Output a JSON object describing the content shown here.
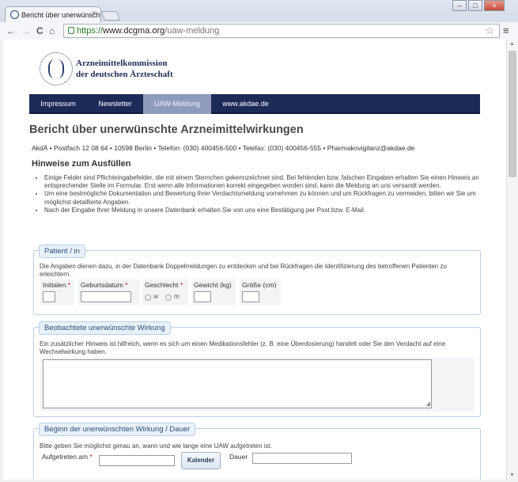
{
  "browser": {
    "tab_title": "Bericht über unerwünschte",
    "tab_close": "×",
    "url_scheme": "https://",
    "url_host": "www.dcgma.org",
    "url_path": "/uaw-meldung",
    "back": "←",
    "forward": "→",
    "reload": "C",
    "home": "⌂",
    "star": "☆",
    "menu": "≡",
    "minimize": "–",
    "maximize": "□",
    "close": "×"
  },
  "header": {
    "org_line1": "Arzneimittelkommission",
    "org_line2": "der deutschen Ärzteschaft"
  },
  "nav": {
    "items": [
      {
        "label": "Impressum"
      },
      {
        "label": "Newsletter"
      },
      {
        "label": "UAW-Meldung"
      },
      {
        "label": "www.akdae.de"
      }
    ]
  },
  "page": {
    "title": "Bericht über unerwünschte Arzneimittelwirkungen",
    "contact": "AkdÄ • Postfach 12 08 64 • 10598 Berlin • Telefon: (030) 400456-500 • Telefax: (030) 400456-555 • Pharmakovigilanz@akdae.de",
    "hints_title": "Hinweise zum Ausfüllen",
    "hints": [
      "Einige Felder sind Pflichteingabefelder, die mit einem Sternchen gekennzeichnet sind. Bei fehlenden bzw. falschen Eingaben erhalten Sie einen Hinweis an entsprechender Stelle im Formular. Erst wenn alle Informationen korrekt eingegeben worden sind, kann die Meldung an uns versandt werden.",
      "Um eine bestmögliche Dokumentation und Bewertung Ihrer Verdachtsmeldung vornehmen zu können und um Rückfragen zu vermeiden, bitten wir Sie um möglichst detaillierte Angaben.",
      "Nach der Eingabe Ihrer Meldung in unsere Datenbank erhalten Sie von uns eine Bestätigung per Post bzw. E-Mail."
    ]
  },
  "patient": {
    "legend": "Patient / in",
    "desc": "Die Angaben dienen dazu, in der Datenbank Doppelmeldungen zu entdecken und bei Rückfragen die Identifizierung des betroffenen Patienten zu erleichtern.",
    "initialen": "Initialen",
    "geburtsdatum": "Geburtsdatum",
    "geschlecht": "Geschlecht",
    "gewicht": "Gewicht (kg)",
    "groesse": "Größe (cm)",
    "w": "w",
    "m": "m",
    "req": "*"
  },
  "wirkung": {
    "legend": "Beobachtete unerwünschte Wirkung",
    "desc": "Ein zusätzlicher Hinweis ist hilfreich, wenn es sich um einen Medikationsfehler (z. B. eine Überdosierung) handelt oder Sie den Verdacht auf eine Wechselwirkung haben."
  },
  "beginn": {
    "legend": "Beginn der unerwünschten Wirkung / Dauer",
    "desc": "Bitte geben Sie möglichst genau an, wann und wie lange eine UAW aufgetreten ist.",
    "aufgetreten": "Aufgetreten am",
    "kalender": "Kalender",
    "dauer": "Dauer",
    "req": "*"
  }
}
